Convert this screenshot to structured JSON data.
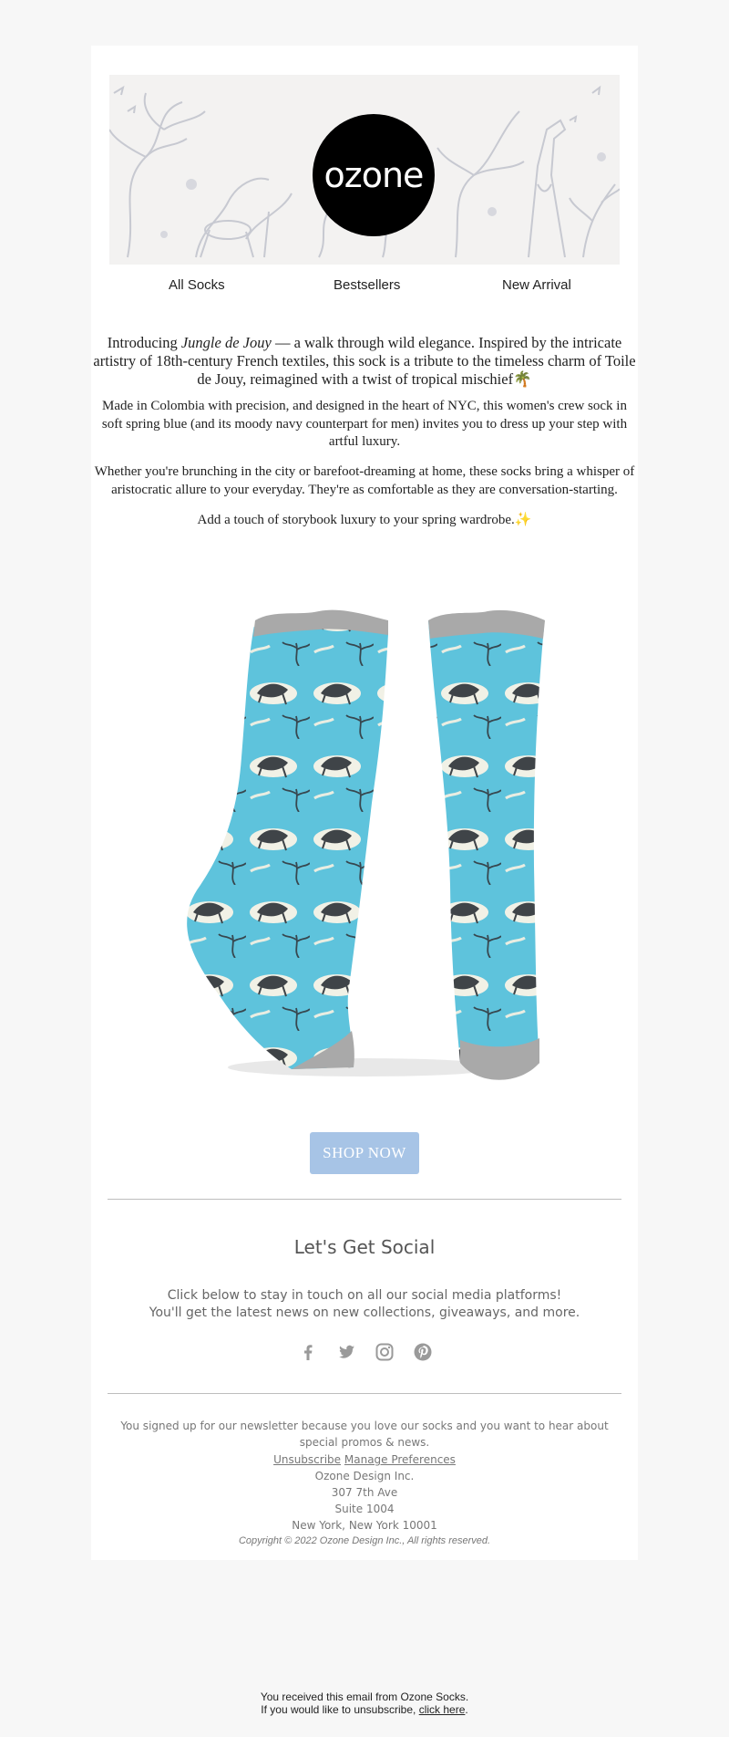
{
  "brand": {
    "logo_text": "ozone"
  },
  "nav": {
    "items": [
      {
        "label": "All Socks"
      },
      {
        "label": "Bestsellers"
      },
      {
        "label": "New Arrival"
      }
    ]
  },
  "intro": {
    "pre": "Introducing ",
    "product_name": "Jungle de Jouy",
    "post": " — a walk through wild elegance. Inspired by the intricate artistry of 18th-century French textiles, this sock is a tribute to the timeless charm of Toile de Jouy, reimagined with a twist of tropical mischief",
    "emoji": "🌴"
  },
  "body": {
    "p2": "Made in Colombia with precision, and designed in the heart of NYC, this women's crew sock in soft spring blue (and its moody navy counterpart for men) invites you to dress up your step with artful luxury.",
    "p3": "Whether you're brunching in the city or barefoot-dreaming at home, these socks bring a whisper of aristocratic allure to your everyday. They're as comfortable as they are conversation-starting.",
    "p4": "Add a touch of storybook luxury to your spring wardrobe.",
    "p4_emoji": "✨"
  },
  "cta": {
    "label": "SHOP NOW"
  },
  "social": {
    "title": "Let's Get Social",
    "line1": "Click below to stay in touch on all our social media platforms!",
    "line2": "You'll get the latest news on new collections, giveaways, and more.",
    "icons": [
      "facebook-icon",
      "twitter-icon",
      "instagram-icon",
      "pinterest-icon"
    ]
  },
  "footer": {
    "signup_note": "You signed up for our newsletter because you love our socks and you want to hear about special promos & news.",
    "unsubscribe": "Unsubscribe",
    "manage": "Manage Preferences",
    "company": "Ozone Design Inc.",
    "address1": "307 7th Ave",
    "address2": "Suite 1004",
    "city": "New York, New York 10001",
    "copyright": "Copyright © 2022 Ozone Design Inc., All rights reserved."
  },
  "bottom": {
    "line1": "You received this email from Ozone Socks.",
    "line2_pre": "If you would like to unsubscribe, ",
    "line2_link": "click here",
    "line2_post": "."
  },
  "colors": {
    "button": "#a7c4e6",
    "sock": "#5ec3dc",
    "background": "#f7f7f7"
  }
}
